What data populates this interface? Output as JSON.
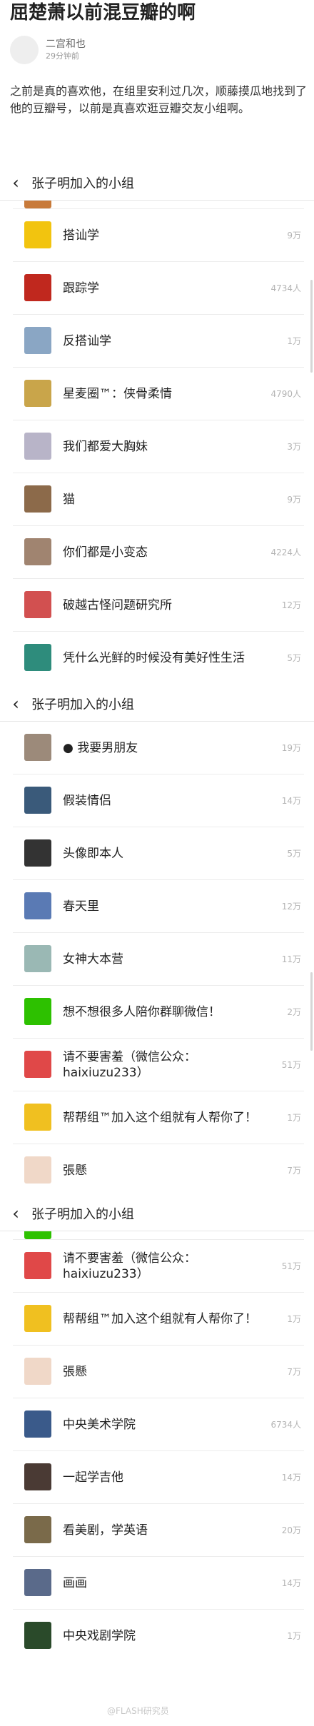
{
  "post": {
    "title": "屈楚萧以前混豆瓣的啊",
    "author": "二宫和也",
    "time": "29分钟前",
    "text": "之前是真的喜欢他，在组里安利过几次，顺藤摸瓜地找到了他的豆瓣号，以前是真喜欢逛豆瓣交友小组啊。"
  },
  "screenshots": [
    {
      "header_title": "张子明加入的小组",
      "rows": [
        {
          "name": "搭讪学",
          "count": "9万",
          "color": "#f2c40f"
        },
        {
          "name": "跟踪学",
          "count": "4734人",
          "color": "#c0281e"
        },
        {
          "name": "反搭讪学",
          "count": "1万",
          "color": "#8aa6c4"
        },
        {
          "name": "星麦圈™：侠骨柔情",
          "count": "4790人",
          "color": "#c9a54a"
        },
        {
          "name": "我们都爱大胸妹",
          "count": "3万",
          "color": "#b8b4c8"
        },
        {
          "name": "猫",
          "count": "9万",
          "color": "#8c6a4a"
        },
        {
          "name": "你们都是小变态",
          "count": "4224人",
          "color": "#a08470"
        },
        {
          "name": "破越古怪问题研究所",
          "count": "12万",
          "color": "#d25050"
        },
        {
          "name": "凭什么光鲜的时候没有美好性生活",
          "count": "5万",
          "color": "#2e8c7c"
        }
      ]
    },
    {
      "header_title": "张子明加入的小组",
      "rows": [
        {
          "name": "● 我要男朋友",
          "count": "19万",
          "color": "#9c8a7a"
        },
        {
          "name": "假装情侣",
          "count": "14万",
          "color": "#3a5a7a"
        },
        {
          "name": "头像即本人",
          "count": "5万",
          "color": "#333333"
        },
        {
          "name": "春天里",
          "count": "12万",
          "color": "#5a7ab4"
        },
        {
          "name": "女神大本营",
          "count": "11万",
          "color": "#9ab8b4"
        },
        {
          "name": "想不想很多人陪你群聊微信！",
          "count": "2万",
          "color": "#2dc100"
        },
        {
          "name": "请不要害羞（微信公众：haixiuzu233）",
          "count": "51万",
          "color": "#e04848"
        },
        {
          "name": "帮帮组™加入这个组就有人帮你了！",
          "count": "1万",
          "color": "#f0c020"
        },
        {
          "name": "張懸",
          "count": "7万",
          "color": "#f0d8c8"
        }
      ]
    },
    {
      "header_title": "张子明加入的小组",
      "rows": [
        {
          "name": "请不要害羞（微信公众：haixiuzu233）",
          "count": "51万",
          "color": "#e04848"
        },
        {
          "name": "帮帮组™加入这个组就有人帮你了！",
          "count": "1万",
          "color": "#f0c020"
        },
        {
          "name": "張懸",
          "count": "7万",
          "color": "#f0d8c8"
        },
        {
          "name": "中央美术学院",
          "count": "6734人",
          "color": "#3a5a8a"
        },
        {
          "name": "一起学吉他",
          "count": "14万",
          "color": "#4a3a34"
        },
        {
          "name": "看美剧，学英语",
          "count": "20万",
          "color": "#7a6a4a"
        },
        {
          "name": "画画",
          "count": "14万",
          "color": "#5a6a8a"
        },
        {
          "name": "中央戏剧学院",
          "count": "1万",
          "color": "#2a4a2a"
        }
      ]
    }
  ],
  "watermark": "@FLASH研究员"
}
